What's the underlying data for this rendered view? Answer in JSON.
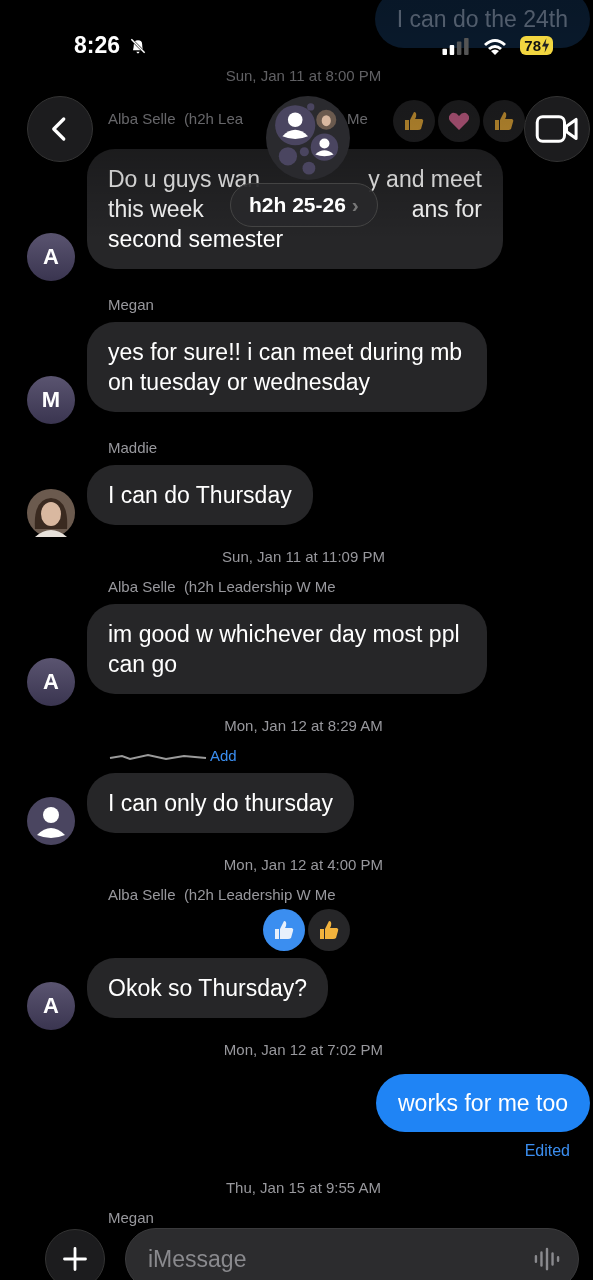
{
  "status_bar": {
    "time": "8:26",
    "silent": true,
    "battery": "78",
    "charging": true
  },
  "header": {
    "title": "h2h 25-26",
    "chevron": "›"
  },
  "feed": [
    {
      "kind": "sent",
      "text": "I can do the 24th"
    },
    {
      "kind": "timestamp",
      "text": "Sun, Jan 11 at 8:00 PM"
    },
    {
      "kind": "received",
      "sender_parts": [
        "Alba Selle  (h2h Lea",
        "Me"
      ],
      "avatar": {
        "kind": "letter",
        "letter": "A"
      },
      "text_parts": [
        [
          "Do u guys wan",
          "y and meet"
        ],
        [
          "this week",
          "ans for"
        ],
        [
          "second semester"
        ]
      ],
      "reactions": [
        {
          "kind": "thumbs_up",
          "from_me": false
        },
        {
          "kind": "heart",
          "from_me": false
        },
        {
          "kind": "thumbs_up",
          "from_me": false
        }
      ]
    },
    {
      "kind": "received",
      "sender": "Megan",
      "avatar": {
        "kind": "letter",
        "letter": "M"
      },
      "text": "yes for sure!! i can meet during mb on tuesday or wednesday"
    },
    {
      "kind": "received",
      "sender": "Maddie",
      "text": "I can do Thursday"
    },
    {
      "kind": "timestamp",
      "text": "Sun, Jan 11 at 11:09 PM"
    },
    {
      "kind": "received",
      "sender": "Alba Selle  (h2h Leadership W Me",
      "avatar": {
        "kind": "letter",
        "letter": "A"
      },
      "text": "im good w whichever day most ppl can go"
    },
    {
      "kind": "timestamp",
      "text": "Mon, Jan 12 at 8:29 AM"
    },
    {
      "kind": "received",
      "redacted_sender": true,
      "add_link": "Add",
      "avatar": {
        "kind": "silhouette"
      },
      "text": "I can only do thursday"
    },
    {
      "kind": "timestamp",
      "text": "Mon, Jan 12 at 4:00 PM"
    },
    {
      "kind": "received",
      "sender": "Alba Selle  (h2h Leadership W Me",
      "avatar": {
        "kind": "letter",
        "letter": "A"
      },
      "text": "Okok so Thursday?",
      "reactions": [
        {
          "kind": "thumbs_up",
          "from_me": true
        },
        {
          "kind": "thumbs_up",
          "from_me": false
        }
      ]
    },
    {
      "kind": "timestamp",
      "text": "Mon, Jan 12 at 7:02 PM"
    },
    {
      "kind": "sent",
      "text": "works for me too",
      "edited": "Edited"
    },
    {
      "kind": "timestamp",
      "text": "Thu, Jan 15 at 9:55 AM"
    },
    {
      "kind": "received",
      "sender": "Megan"
    }
  ],
  "composer": {
    "placeholder": "iMessage"
  }
}
